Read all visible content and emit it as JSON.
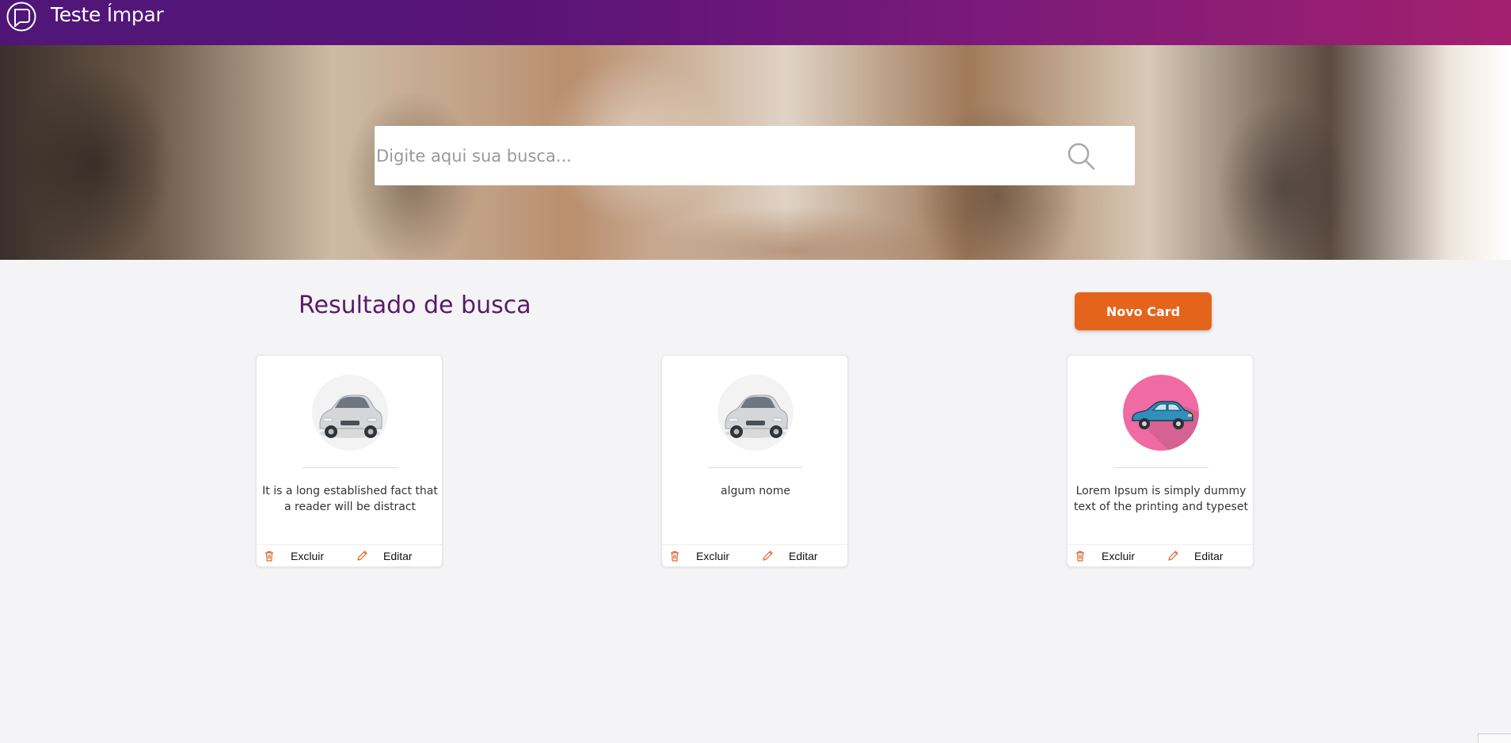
{
  "header": {
    "title_bold": "Teste",
    "title_thin": "Ímpar",
    "logo_icon": "speech-bubble-logo-icon"
  },
  "search": {
    "placeholder": "Digite aqui sua busca...",
    "icon": "search-icon"
  },
  "results": {
    "title": "Resultado de busca",
    "new_card_label": "Novo Card"
  },
  "cards": [
    {
      "image_icon": "silver-car-image",
      "text": "It is a long established fact that a reader will be distract",
      "delete_label": "Excluir",
      "edit_label": "Editar"
    },
    {
      "image_icon": "silver-car-image",
      "text": "algum nome",
      "delete_label": "Excluir",
      "edit_label": "Editar"
    },
    {
      "image_icon": "blue-car-pink-circle-image",
      "text": "Lorem Ipsum is simply dummy text of the printing and typeset",
      "delete_label": "Excluir",
      "edit_label": "Editar"
    }
  ],
  "colors": {
    "header_start": "#4f1678",
    "header_end": "#a3206f",
    "accent": "#e5641c",
    "title": "#5a1a6a"
  }
}
